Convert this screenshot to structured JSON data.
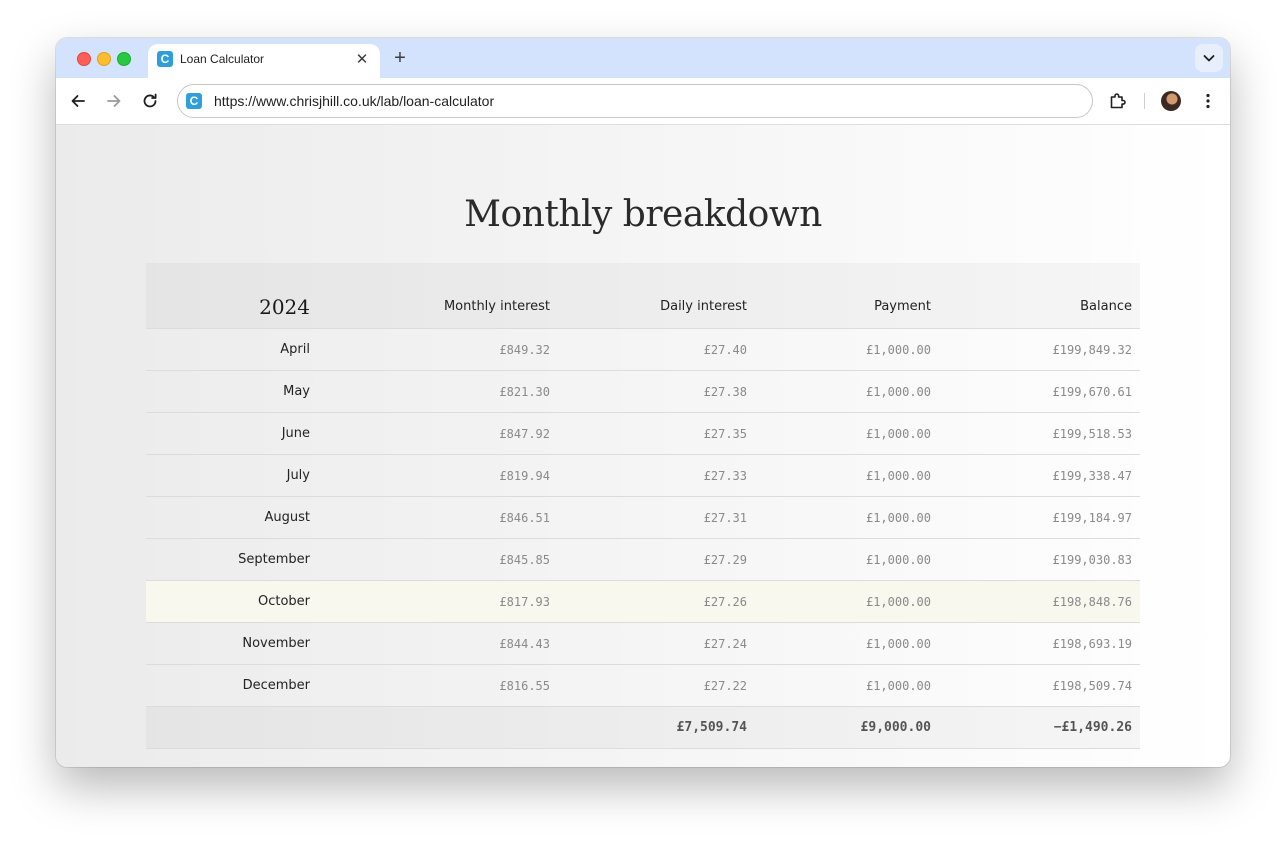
{
  "browser": {
    "tab_title": "Loan Calculator",
    "favicon_letter": "C",
    "url": "https://www.chrisjhill.co.uk/lab/loan-calculator",
    "tab_close": "✕",
    "new_tab": "+"
  },
  "page": {
    "title": "Monthly breakdown"
  },
  "table": {
    "year": "2024",
    "headers": {
      "monthly_interest": "Monthly interest",
      "daily_interest": "Daily interest",
      "payment": "Payment",
      "balance": "Balance"
    },
    "rows": [
      {
        "month": "April",
        "monthly_interest": "£849.32",
        "daily_interest": "£27.40",
        "payment": "£1,000.00",
        "balance": "£199,849.32"
      },
      {
        "month": "May",
        "monthly_interest": "£821.30",
        "daily_interest": "£27.38",
        "payment": "£1,000.00",
        "balance": "£199,670.61"
      },
      {
        "month": "June",
        "monthly_interest": "£847.92",
        "daily_interest": "£27.35",
        "payment": "£1,000.00",
        "balance": "£199,518.53"
      },
      {
        "month": "July",
        "monthly_interest": "£819.94",
        "daily_interest": "£27.33",
        "payment": "£1,000.00",
        "balance": "£199,338.47"
      },
      {
        "month": "August",
        "monthly_interest": "£846.51",
        "daily_interest": "£27.31",
        "payment": "£1,000.00",
        "balance": "£199,184.97"
      },
      {
        "month": "September",
        "monthly_interest": "£845.85",
        "daily_interest": "£27.29",
        "payment": "£1,000.00",
        "balance": "£199,030.83"
      },
      {
        "month": "October",
        "monthly_interest": "£817.93",
        "daily_interest": "£27.26",
        "payment": "£1,000.00",
        "balance": "£198,848.76",
        "highlighted": true
      },
      {
        "month": "November",
        "monthly_interest": "£844.43",
        "daily_interest": "£27.24",
        "payment": "£1,000.00",
        "balance": "£198,693.19"
      },
      {
        "month": "December",
        "monthly_interest": "£816.55",
        "daily_interest": "£27.22",
        "payment": "£1,000.00",
        "balance": "£198,509.74"
      }
    ],
    "totals": {
      "daily_interest": "£7,509.74",
      "payment": "£9,000.00",
      "balance": "−£1,490.26"
    }
  },
  "colors": {
    "tab_strip": "#d3e3fd",
    "favicon": "#2e9fd8",
    "highlight_row": "#f8f8ef"
  }
}
